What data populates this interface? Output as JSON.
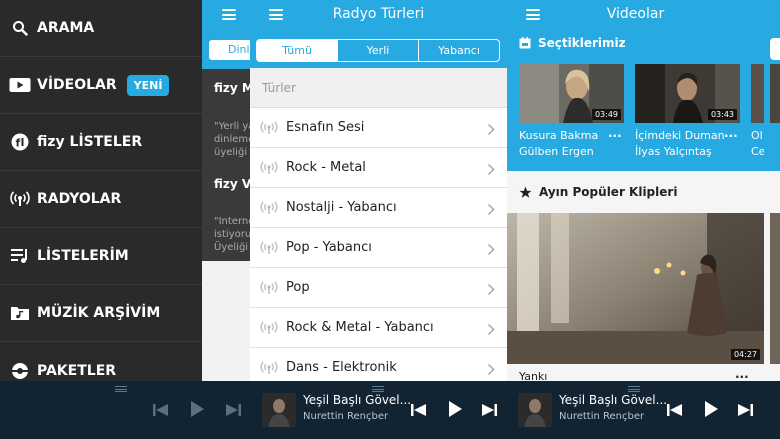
{
  "drawer": {
    "items": [
      {
        "label": "ARAMA",
        "icon": "search-icon"
      },
      {
        "label": "VİDEOLAR",
        "icon": "video-icon",
        "badge": "YENİ"
      },
      {
        "label": "fizy LİSTELER",
        "icon": "fizy-logo-icon"
      },
      {
        "label": "RADYOLAR",
        "icon": "radio-icon"
      },
      {
        "label": "LİSTELERİM",
        "icon": "playlist-icon"
      },
      {
        "label": "MÜZİK ARŞİVİM",
        "icon": "folder-music-icon"
      },
      {
        "label": "PAKETLER",
        "icon": "package-icon"
      }
    ]
  },
  "panel1": {
    "segment": "Dinle",
    "items": [
      {
        "title": "fizy Mü",
        "desc": [
          "\"Yerli ya",
          "dinleme",
          "üyeliği i"
        ]
      },
      {
        "title": "fizy Vid",
        "desc": [
          "\"Interne",
          "istiyoru",
          "Üyeliği i"
        ]
      }
    ]
  },
  "radio": {
    "title": "Radyo Türleri",
    "segments": [
      "Tümü",
      "Yerli",
      "Yabancı"
    ],
    "section": "Türler",
    "genres": [
      "Esnafın Sesi",
      "Rock - Metal",
      "Nostalji - Yabancı",
      "Pop - Yabancı",
      "Pop",
      "Rock & Metal - Yabancı",
      "Dans - Elektronik"
    ]
  },
  "videos": {
    "title": "Videolar",
    "picks_title": "Seçtiklerimiz",
    "picks": [
      {
        "title": "Kusura Bakma",
        "artist": "Gülben Ergen",
        "duration": "03:49"
      },
      {
        "title": "İçimdeki Duman",
        "artist": "İlyas Yalçıntaş",
        "duration": "03:43"
      },
      {
        "title": "Ol",
        "artist": "Ce",
        "duration": ""
      }
    ],
    "popular_title": "Ayın Popüler Klipleri",
    "popular": {
      "title": "Yankı",
      "duration": "04:27"
    },
    "more": "..."
  },
  "player": {
    "track": "Yeşil Başlı Gövel...",
    "artist": "Nurettin Rençber"
  },
  "colors": {
    "accent": "#27a9e1",
    "drawer": "#2a2a2a",
    "player": "#122332"
  }
}
